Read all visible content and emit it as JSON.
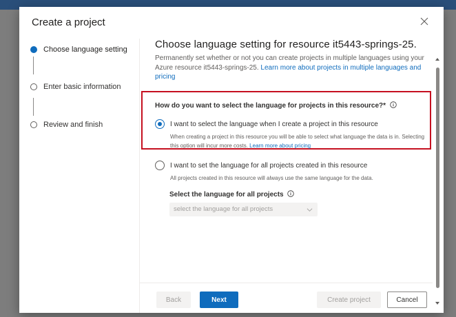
{
  "dialog": {
    "title": "Create a project"
  },
  "steps": [
    {
      "label": "Choose language setting",
      "state": "active"
    },
    {
      "label": "Enter basic information",
      "state": "inactive"
    },
    {
      "label": "Review and finish",
      "state": "inactive"
    }
  ],
  "content": {
    "title": "Choose language setting for resource it5443-springs-25.",
    "description": "Permanently set whether or not you can create projects in multiple languages using your Azure resource it5443-springs-25.",
    "description_link": "Learn more about projects in multiple languages and pricing",
    "question": "How do you want to select the language for projects in this resource?*",
    "options": [
      {
        "label": "I want to select the language when I create a project in this resource",
        "description": "When creating a project in this resource you will be able to select what language the data is in. Selecting this option will incur more costs.",
        "link": "Learn more about pricing",
        "checked": true
      },
      {
        "label": "I want to set the language for all projects created in this resource",
        "description": "All projects created in this resource will always use the same language for the data.",
        "checked": false
      }
    ],
    "select_label": "Select the language for all projects",
    "select_placeholder": "select the language for all projects"
  },
  "footer": {
    "back": "Back",
    "next": "Next",
    "create": "Create project",
    "cancel": "Cancel"
  },
  "colors": {
    "accent": "#0f6cbd",
    "highlight_border": "#c50f1f"
  },
  "icons": {
    "close": "close-icon",
    "info": "info-icon",
    "chevron": "chevron-down-icon"
  }
}
